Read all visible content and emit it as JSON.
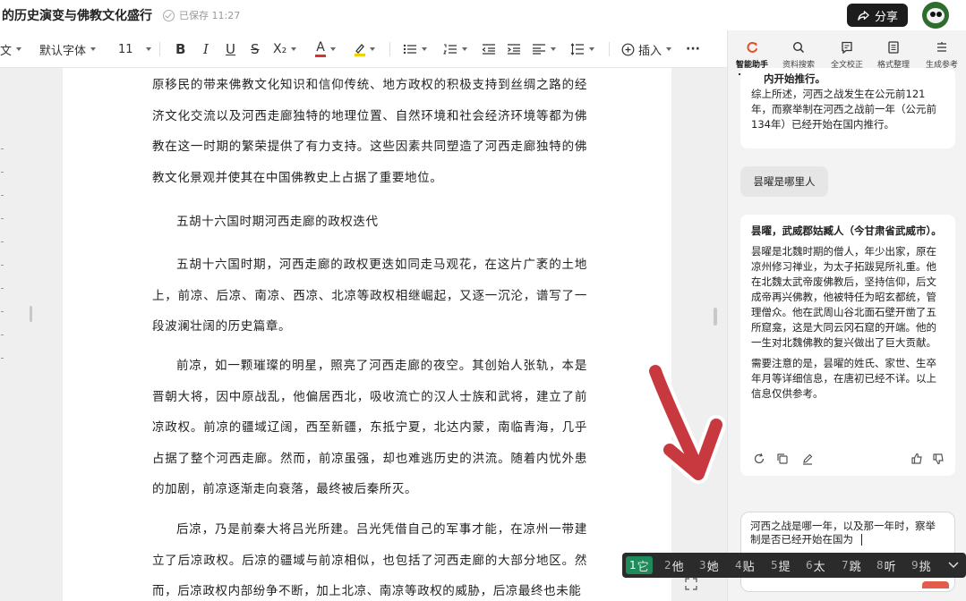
{
  "header": {
    "doc_title": "的历史演变与佛教文化盛行",
    "saved_text": "已保存 11:27",
    "share_label": "分享"
  },
  "toolbar": {
    "text_partial": "文",
    "font_family": "默认字体",
    "font_size": "11",
    "bold": "B",
    "italic": "I",
    "underline": "U",
    "strike": "S",
    "subscript": "X₂",
    "font_color_glyph": "A",
    "insert_label": "插入",
    "more": "···"
  },
  "document": {
    "paragraphs": [
      "原移民的带来佛教文化知识和信仰传统、地方政权的积极支持到丝绸之路的经济文化交流以及河西走廊独特的地理位置、自然环境和社会经济环境等都为佛教在这一时期的繁荣提供了有力支持。这些因素共同塑造了河西走廊独特的佛教文化景观并使其在中国佛教史上占据了重要地位。",
      "五胡十六国时期河西走廊的政权迭代",
      "五胡十六国时期，河西走廊的政权更迭如同走马观花，在这片广袤的土地上，前凉、后凉、南凉、西凉、北凉等政权相继崛起，又逐一沉沦，谱写了一段波澜壮阔的历史篇章。",
      "前凉，如一颗璀璨的明星，照亮了河西走廊的夜空。其创始人张轨，本是晋朝大将，因中原战乱，他偏居西北，吸收流亡的汉人士族和武将，建立了前凉政权。前凉的疆域辽阔，西至新疆，东抵宁夏，北达内蒙，南临青海，几乎占据了整个河西走廊。然而，前凉虽强，却也难逃历史的洪流。随着内忧外患的加剧，前凉逐渐走向衰落，最终被后秦所灭。",
      "后凉，乃是前秦大将吕光所建。吕光凭借自己的军事才能，在凉州一带建立了后凉政权。后凉的疆域与前凉相似，也包括了河西走廊的大部分地区。然而，后凉政权内部纷争不断，加上北凉、南凉等政权的威胁，后凉最终也未能"
    ]
  },
  "panel": {
    "tabs": [
      {
        "label": "智能助手",
        "icon": "assistant-icon",
        "active": true
      },
      {
        "label": "资料搜索",
        "icon": "search-icon"
      },
      {
        "label": "全文校正",
        "icon": "proofread-icon"
      },
      {
        "label": "格式整理",
        "icon": "format-icon"
      },
      {
        "label": "生成参考",
        "icon": "reference-icon"
      }
    ],
    "messages": {
      "top_answer_partial": "内开始推行。",
      "top_answer": "综上所述，河西之战发生在公元前121年，而察举制在河西之战前一年（公元前134年）已经开始在国内推行。",
      "user_question": "昙曜是哪里人",
      "answer_heading": "昙曜，武威郡姑臧人（今甘肃省武威市）。",
      "answer_body": "昙曜是北魏时期的僧人，年少出家，原在凉州修习禅业，为太子拓跋晃所礼重。他在北魏太武帝废佛教后，坚持信仰，后文成帝再兴佛教，他被特任为昭玄都统，管理僧众。他在武周山谷北面石壁开凿了五所窟龛，这是大同云冈石窟的开端。他的一生对北魏佛教的复兴做出了巨大贡献。",
      "answer_note": "需要注意的是，昙曜的姓氏、家世、生卒年月等详细信息，在唐初已经不详。以上信息仅供参考。"
    },
    "input_text": "河西之战是哪一年，以及那一年时，察举制是否已经开始在国为"
  },
  "ime": {
    "candidates": [
      {
        "num": "1",
        "text": "它",
        "selected": true
      },
      {
        "num": "2",
        "text": "他"
      },
      {
        "num": "3",
        "text": "她"
      },
      {
        "num": "4",
        "text": "贴"
      },
      {
        "num": "5",
        "text": "提"
      },
      {
        "num": "6",
        "text": "太"
      },
      {
        "num": "7",
        "text": "跳"
      },
      {
        "num": "8",
        "text": "听"
      },
      {
        "num": "9",
        "text": "挑"
      }
    ]
  },
  "colors": {
    "accent": "#e0502d",
    "ime_selected": "#1f8a5a",
    "arrow": "#c8393f"
  }
}
